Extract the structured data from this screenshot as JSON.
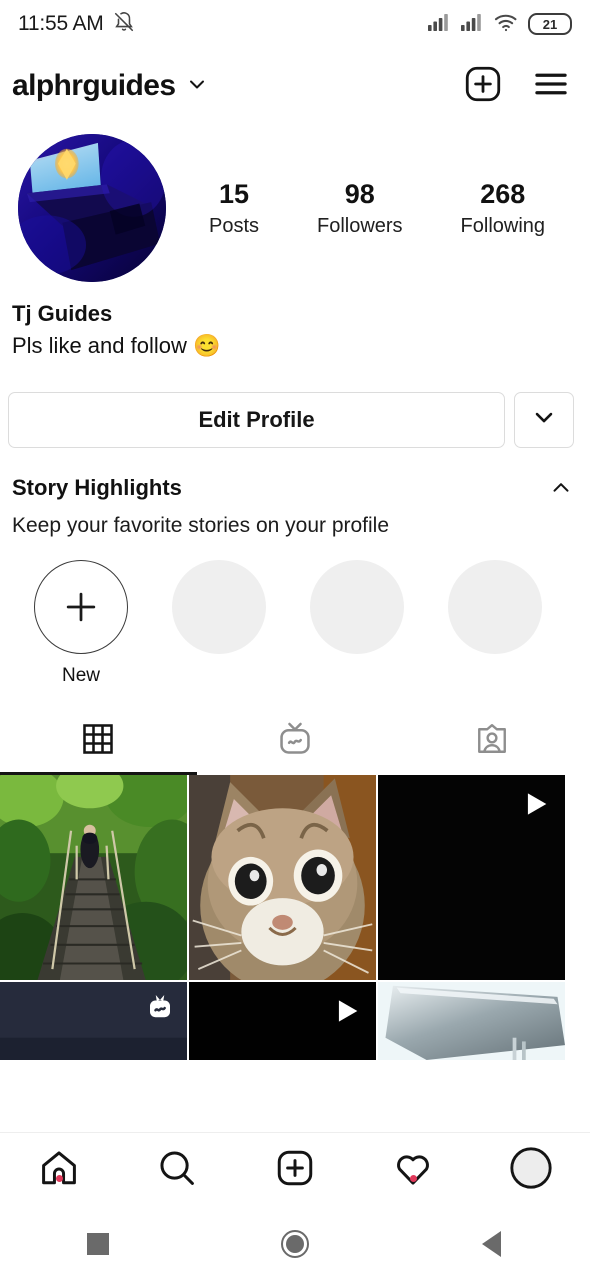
{
  "status_bar": {
    "time": "11:55 AM",
    "bell_icon": "bell-muted-icon",
    "signal_icon_1": "signal-bars-icon",
    "signal_icon_2": "signal-bars-icon",
    "wifi_icon": "wifi-icon",
    "battery_percent": "21"
  },
  "header": {
    "username": "alphrguides",
    "dropdown_icon": "chevron-down-icon",
    "add_icon": "add-post-icon",
    "menu_icon": "hamburger-menu-icon"
  },
  "profile": {
    "avatar_alt": "gaming-desk-blue-light",
    "stats": [
      {
        "value": "15",
        "label": "Posts"
      },
      {
        "value": "98",
        "label": "Followers"
      },
      {
        "value": "268",
        "label": "Following"
      }
    ],
    "display_name": "Tj Guides",
    "bio": "Pls like and follow 😊"
  },
  "actions": {
    "edit_profile_label": "Edit Profile",
    "dropdown_icon": "chevron-down-icon"
  },
  "highlights": {
    "title": "Story Highlights",
    "subtitle": "Keep your favorite stories on your profile",
    "collapse_icon": "chevron-up-icon",
    "new_label": "New",
    "placeholder_count": 3
  },
  "tabs": [
    {
      "name": "grid",
      "icon": "grid-icon",
      "active": true
    },
    {
      "name": "igtv",
      "icon": "igtv-icon",
      "active": false
    },
    {
      "name": "tagged",
      "icon": "tagged-person-icon",
      "active": false
    }
  ],
  "grid_posts": [
    {
      "type": "photo",
      "art": "jungle-rope-bridge",
      "badge": ""
    },
    {
      "type": "photo",
      "art": "kitten-closeup",
      "badge": ""
    },
    {
      "type": "video",
      "art": "black",
      "badge": "play-icon"
    },
    {
      "type": "video",
      "art": "dark-navy",
      "badge": "igtv-icon"
    },
    {
      "type": "video",
      "art": "black",
      "badge": "play-icon"
    },
    {
      "type": "photo",
      "art": "silver-laptop",
      "badge": ""
    }
  ],
  "bottom_nav": [
    {
      "name": "home",
      "icon": "home-icon",
      "badge": true
    },
    {
      "name": "search",
      "icon": "search-icon",
      "badge": false
    },
    {
      "name": "create",
      "icon": "add-post-icon",
      "badge": false
    },
    {
      "name": "activity",
      "icon": "heart-icon",
      "badge": true
    },
    {
      "name": "profile",
      "icon": "avatar-circle-icon",
      "badge": false
    }
  ],
  "system_nav": [
    {
      "name": "recents",
      "icon": "square-icon"
    },
    {
      "name": "home",
      "icon": "circle-icon"
    },
    {
      "name": "back",
      "icon": "triangle-back-icon"
    }
  ],
  "colors": {
    "accent_red": "#e0395a",
    "text": "#111111",
    "border": "#dcdcdc",
    "placeholder": "#efefef"
  }
}
